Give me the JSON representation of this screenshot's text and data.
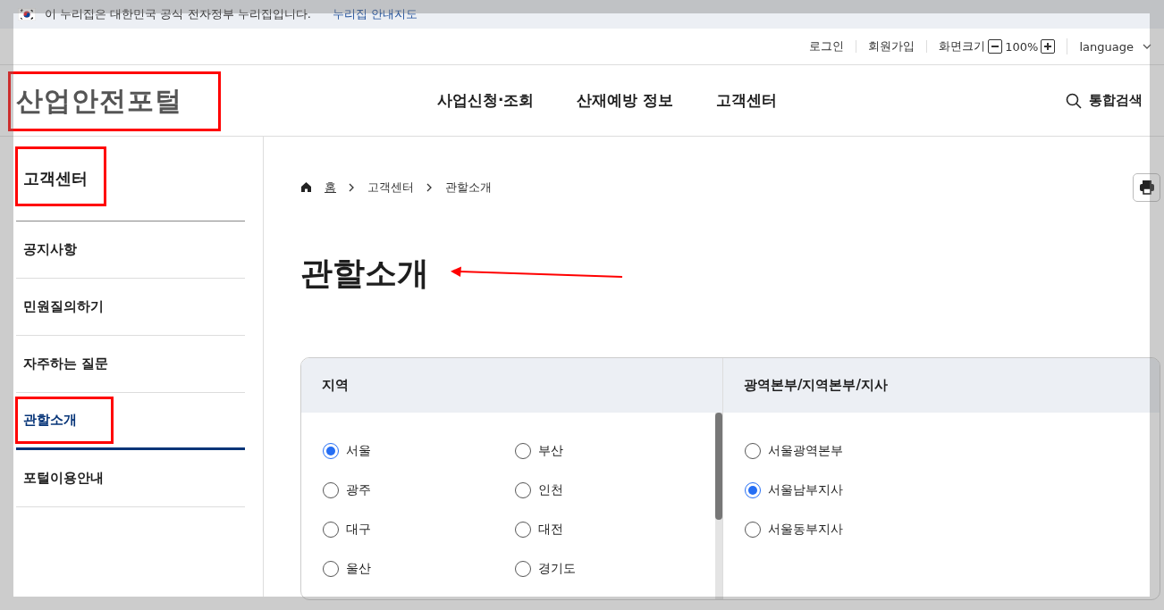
{
  "gov_banner": {
    "text": "이 누리집은 대한민국 공식 전자정부 누리집입니다.",
    "link": "누리집 안내지도"
  },
  "utility_links": [
    "로그인",
    "회원가입"
  ],
  "zoom": {
    "label": "화면크기",
    "value": "100%"
  },
  "language": "language",
  "logo": {
    "text": "산업안전포털",
    "highlighted": true
  },
  "nav": [
    "사업신청·조회",
    "산재예방 정보",
    "고객센터"
  ],
  "search_label": "통합검색",
  "sidebar": {
    "title": "고객센터",
    "title_highlighted": true,
    "items": [
      {
        "label": "공지사항",
        "selected": false,
        "highlighted": false
      },
      {
        "label": "민원질의하기",
        "selected": false,
        "highlighted": false
      },
      {
        "label": "자주하는 질문",
        "selected": false,
        "highlighted": false
      },
      {
        "label": "관할소개",
        "selected": true,
        "highlighted": true
      },
      {
        "label": "포털이용안내",
        "selected": false,
        "highlighted": false
      }
    ]
  },
  "breadcrumb": [
    "홈",
    "고객센터",
    "관할소개"
  ],
  "page_title": {
    "text": "관할소개",
    "pointer_arrow": true
  },
  "selector": {
    "region_header": "지역",
    "office_header": "광역본부/지역본부/지사",
    "regions": [
      {
        "label": "서울",
        "selected": true
      },
      {
        "label": "부산",
        "selected": false
      },
      {
        "label": "광주",
        "selected": false
      },
      {
        "label": "인천",
        "selected": false
      },
      {
        "label": "대구",
        "selected": false
      },
      {
        "label": "대전",
        "selected": false
      },
      {
        "label": "울산",
        "selected": false
      },
      {
        "label": "경기도",
        "selected": false
      }
    ],
    "offices": [
      {
        "label": "서울광역본부",
        "selected": false
      },
      {
        "label": "서울남부지사",
        "selected": true
      },
      {
        "label": "서울동부지사",
        "selected": false
      }
    ]
  }
}
